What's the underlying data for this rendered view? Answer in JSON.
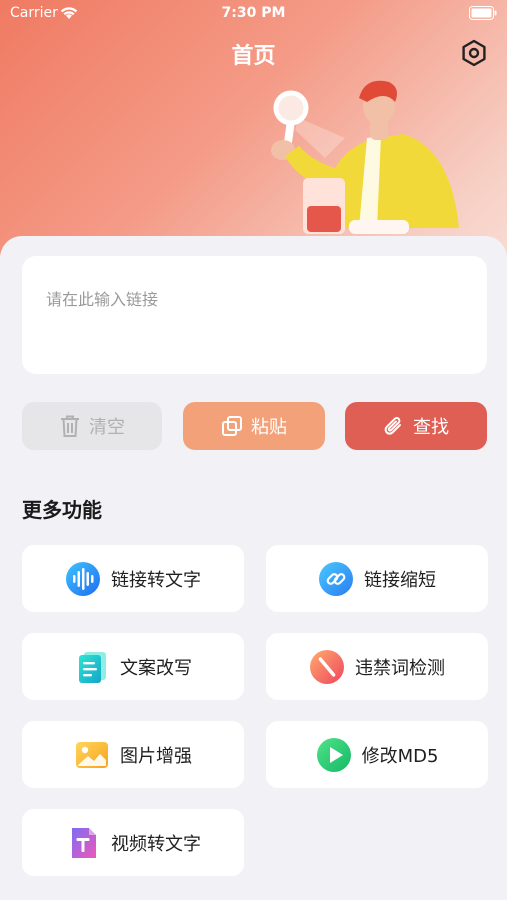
{
  "status": {
    "carrier": "Carrier",
    "time": "7:30 PM"
  },
  "header": {
    "title": "首页"
  },
  "input": {
    "placeholder": "请在此输入链接"
  },
  "actions": {
    "clear": "清空",
    "paste": "粘贴",
    "search": "查找"
  },
  "more": {
    "title": "更多功能",
    "items": [
      {
        "label": "链接转文字",
        "icon": "audio-wave-icon"
      },
      {
        "label": "链接缩短",
        "icon": "link-icon"
      },
      {
        "label": "文案改写",
        "icon": "document-icon"
      },
      {
        "label": "违禁词检测",
        "icon": "forbidden-icon"
      },
      {
        "label": "图片增强",
        "icon": "image-icon"
      },
      {
        "label": "修改MD5",
        "icon": "play-icon"
      },
      {
        "label": "视频转文字",
        "icon": "text-t-icon"
      }
    ]
  },
  "colors": {
    "header_gradient_start": "#f07a62",
    "paste_button": "#f2a179",
    "search_button": "#df5f55",
    "clear_button": "#e6e6e8",
    "background": "#f2f1f6"
  }
}
